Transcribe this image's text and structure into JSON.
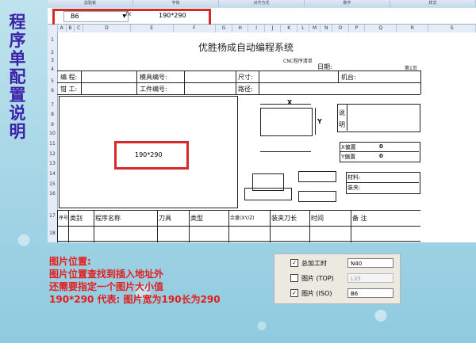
{
  "side_title": [
    "程",
    "序",
    "单",
    "配",
    "置",
    "说",
    "明"
  ],
  "ribbon": [
    "剪贴板",
    "字体",
    "对齐方式",
    "数字",
    "样式"
  ],
  "formula_bar": {
    "name_box": "B6",
    "fx": "fx",
    "value": "190*290"
  },
  "columns": [
    "A",
    "B",
    "C",
    "D",
    "E",
    "F",
    "G",
    "H",
    "I",
    "J",
    "K",
    "L",
    "M",
    "N",
    "O",
    "P",
    "Q",
    "R",
    "S"
  ],
  "rows": [
    "1",
    "2",
    "3",
    "4",
    "5",
    "6",
    "7",
    "8",
    "9",
    "10",
    "11",
    "12",
    "13",
    "14",
    "15",
    "16",
    "17",
    "18"
  ],
  "sheet": {
    "title": "优胜杨成自动编程系统",
    "subtitle": "CNC程序清单",
    "date_label": "日期:",
    "page_label": "第1页",
    "row4": {
      "code": "编  程:",
      "mold": "模具编号:",
      "size": "尺寸:",
      "machine": "机台:"
    },
    "row5": {
      "fitter": "钳  工:",
      "part": "工件编号:",
      "path": "路径:"
    },
    "diagram": {
      "x": "X",
      "y": "Y"
    },
    "desc": "说",
    "bright": "明",
    "x_off": "X偏置",
    "x_val": "0",
    "y_off": "Y偏置",
    "y_val": "0",
    "material": "材料:",
    "fixture": "装夹:",
    "picture_size": "190*290",
    "table_headers": [
      "序号",
      "类别",
      "程序名称",
      "刀具",
      "类型",
      "余量(XY/Z)",
      "装夹刀长",
      "时间",
      "备  注"
    ]
  },
  "notes": [
    "图片位置:",
    "图片位置查找到插入地址外",
    "还需要指定一个图片大小值",
    "190*290 代表: 图片宽为190长为290"
  ],
  "options": [
    {
      "label": "总加工时",
      "checked": true,
      "value": "N40",
      "disabled": false
    },
    {
      "label": "图片 (TOP)",
      "checked": false,
      "value": "L35",
      "disabled": true
    },
    {
      "label": "图片 (ISO)",
      "checked": true,
      "value": "B6",
      "disabled": false
    }
  ],
  "colors": {
    "accent_red": "#d62a2a",
    "title_blue": "#3b22a8",
    "note_red": "#e31d1d"
  }
}
